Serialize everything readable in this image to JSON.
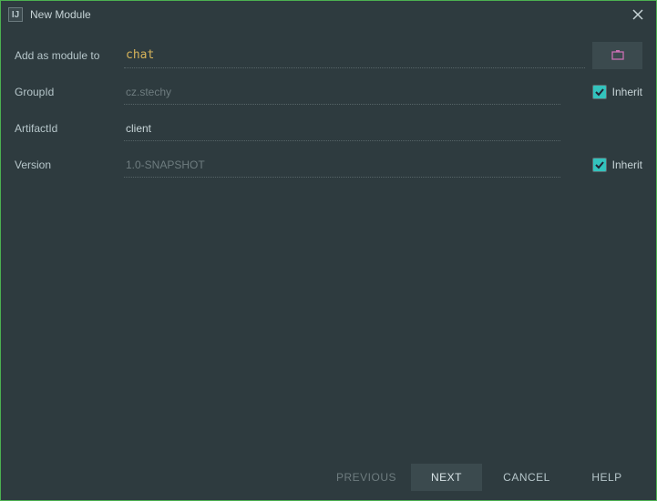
{
  "window": {
    "title": "New Module"
  },
  "form": {
    "addAsModuleTo": {
      "label": "Add as module to",
      "value": "chat"
    },
    "groupId": {
      "label": "GroupId",
      "value": "cz.stechy",
      "inheritLabel": "Inherit",
      "inheritChecked": true
    },
    "artifactId": {
      "label": "ArtifactId",
      "value": "client"
    },
    "version": {
      "label": "Version",
      "value": "1.0-SNAPSHOT",
      "inheritLabel": "Inherit",
      "inheritChecked": true
    }
  },
  "footer": {
    "previous": "PREVIOUS",
    "next": "NEXT",
    "cancel": "CANCEL",
    "help": "HELP"
  }
}
